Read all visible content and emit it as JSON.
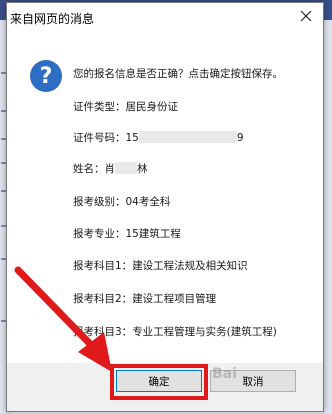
{
  "dialog": {
    "title": "来自网页的消息",
    "question": "您的报名信息是否正确？点击确定按钮保存。",
    "fields": [
      {
        "label": "证件类型：",
        "value": "居民身份证"
      },
      {
        "label": "证件号码：",
        "value": "15",
        "value_suffix": "9"
      },
      {
        "label": "姓名：",
        "value": "肖",
        "value_suffix": "林"
      },
      {
        "label": "报考级别：",
        "value": "04考全科"
      },
      {
        "label": "报考专业：",
        "value": "15建筑工程"
      },
      {
        "label": "报考科目1：",
        "value": "建设工程法规及相关知识"
      },
      {
        "label": "报考科目2：",
        "value": "建设工程项目管理"
      },
      {
        "label": "报考科目3：",
        "value": "专业工程管理与实务(建筑工程)"
      }
    ],
    "ok_label": "确定",
    "cancel_label": "取消"
  },
  "watermark": "Bai",
  "colors": {
    "highlight": "#e0191b",
    "icon": "#2d6dc4"
  }
}
